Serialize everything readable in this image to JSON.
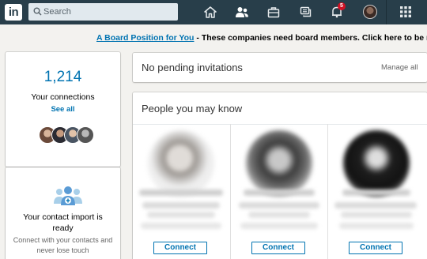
{
  "nav": {
    "logo_text": "in",
    "search_placeholder": "Search",
    "notification_count": "5",
    "icons": [
      "home-icon",
      "my-network-icon",
      "jobs-icon",
      "messaging-icon",
      "notifications-icon",
      "me-avatar",
      "apps-grid-icon"
    ]
  },
  "announcement": {
    "link": "A Board Position for You",
    "text": " - These companies need board members. Click here to be mat"
  },
  "connections": {
    "count": "1,214",
    "label": "Your connections",
    "see_all": "See all"
  },
  "contact_import": {
    "title": "Your contact import is ready",
    "subtitle": "Connect with your contacts and never lose touch"
  },
  "invitations": {
    "title": "No pending invitations",
    "manage_all": "Manage all"
  },
  "pymk": {
    "title": "People you may know",
    "people": [
      {
        "connect_label": "Connect"
      },
      {
        "connect_label": "Connect"
      },
      {
        "connect_label": "Connect"
      }
    ]
  },
  "colors": {
    "nav_bg": "#283e4a",
    "link_blue": "#0073b1",
    "badge_red": "#d11124",
    "page_bg": "#f3f2ef"
  }
}
